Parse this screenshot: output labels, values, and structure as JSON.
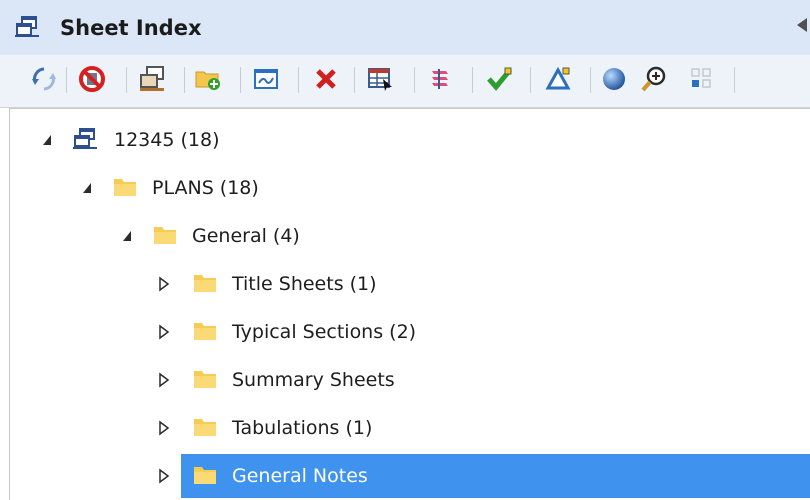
{
  "panel": {
    "title": "Sheet Index",
    "title_icon": "sheet-index-icon"
  },
  "toolbar": {
    "buttons": [
      {
        "name": "refresh-icon"
      },
      {
        "name": "disable-icon"
      },
      {
        "name": "create-sheet-index-icon"
      },
      {
        "name": "add-folder-icon"
      },
      {
        "name": "add-sheet-icon"
      },
      {
        "name": "delete-icon"
      },
      {
        "name": "properties-table-icon"
      },
      {
        "name": "batch-print-icon"
      },
      {
        "name": "validate-icon"
      },
      {
        "name": "drawing-boundary-icon"
      },
      {
        "name": "sphere-icon"
      },
      {
        "name": "zoom-icon"
      },
      {
        "name": "grid-icon"
      }
    ]
  },
  "tree": {
    "items": [
      {
        "label": "12345 (18)",
        "level": 0,
        "expanded": true,
        "icon": "sheet-index-icon"
      },
      {
        "label": "PLANS (18)",
        "level": 1,
        "expanded": true,
        "icon": "folder-icon"
      },
      {
        "label": "General (4)",
        "level": 2,
        "expanded": true,
        "icon": "folder-icon"
      },
      {
        "label": "Title Sheets (1)",
        "level": 3,
        "expanded": false,
        "icon": "folder-icon"
      },
      {
        "label": "Typical Sections (2)",
        "level": 3,
        "expanded": false,
        "icon": "folder-icon"
      },
      {
        "label": "Summary Sheets",
        "level": 3,
        "expanded": false,
        "icon": "folder-icon"
      },
      {
        "label": "Tabulations (1)",
        "level": 3,
        "expanded": false,
        "icon": "folder-icon"
      },
      {
        "label": "General Notes",
        "level": 3,
        "expanded": false,
        "icon": "folder-icon",
        "selected": true
      }
    ]
  },
  "colors": {
    "title_bar": "#dbe6f6",
    "toolbar": "#eef2f9",
    "selection": "#3f93ee",
    "folder": "#f5cd54"
  }
}
